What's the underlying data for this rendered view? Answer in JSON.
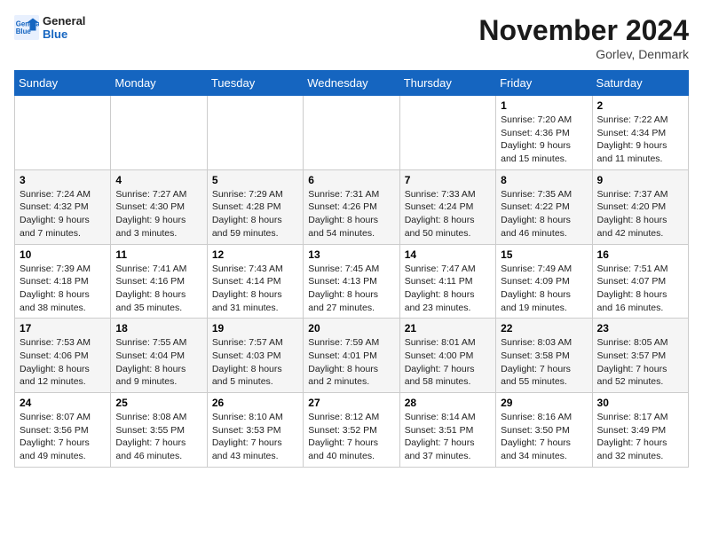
{
  "header": {
    "logo_line1": "General",
    "logo_line2": "Blue",
    "month": "November 2024",
    "location": "Gorlev, Denmark"
  },
  "weekdays": [
    "Sunday",
    "Monday",
    "Tuesday",
    "Wednesday",
    "Thursday",
    "Friday",
    "Saturday"
  ],
  "weeks": [
    [
      {
        "day": "",
        "info": ""
      },
      {
        "day": "",
        "info": ""
      },
      {
        "day": "",
        "info": ""
      },
      {
        "day": "",
        "info": ""
      },
      {
        "day": "",
        "info": ""
      },
      {
        "day": "1",
        "info": "Sunrise: 7:20 AM\nSunset: 4:36 PM\nDaylight: 9 hours and 15 minutes."
      },
      {
        "day": "2",
        "info": "Sunrise: 7:22 AM\nSunset: 4:34 PM\nDaylight: 9 hours and 11 minutes."
      }
    ],
    [
      {
        "day": "3",
        "info": "Sunrise: 7:24 AM\nSunset: 4:32 PM\nDaylight: 9 hours and 7 minutes."
      },
      {
        "day": "4",
        "info": "Sunrise: 7:27 AM\nSunset: 4:30 PM\nDaylight: 9 hours and 3 minutes."
      },
      {
        "day": "5",
        "info": "Sunrise: 7:29 AM\nSunset: 4:28 PM\nDaylight: 8 hours and 59 minutes."
      },
      {
        "day": "6",
        "info": "Sunrise: 7:31 AM\nSunset: 4:26 PM\nDaylight: 8 hours and 54 minutes."
      },
      {
        "day": "7",
        "info": "Sunrise: 7:33 AM\nSunset: 4:24 PM\nDaylight: 8 hours and 50 minutes."
      },
      {
        "day": "8",
        "info": "Sunrise: 7:35 AM\nSunset: 4:22 PM\nDaylight: 8 hours and 46 minutes."
      },
      {
        "day": "9",
        "info": "Sunrise: 7:37 AM\nSunset: 4:20 PM\nDaylight: 8 hours and 42 minutes."
      }
    ],
    [
      {
        "day": "10",
        "info": "Sunrise: 7:39 AM\nSunset: 4:18 PM\nDaylight: 8 hours and 38 minutes."
      },
      {
        "day": "11",
        "info": "Sunrise: 7:41 AM\nSunset: 4:16 PM\nDaylight: 8 hours and 35 minutes."
      },
      {
        "day": "12",
        "info": "Sunrise: 7:43 AM\nSunset: 4:14 PM\nDaylight: 8 hours and 31 minutes."
      },
      {
        "day": "13",
        "info": "Sunrise: 7:45 AM\nSunset: 4:13 PM\nDaylight: 8 hours and 27 minutes."
      },
      {
        "day": "14",
        "info": "Sunrise: 7:47 AM\nSunset: 4:11 PM\nDaylight: 8 hours and 23 minutes."
      },
      {
        "day": "15",
        "info": "Sunrise: 7:49 AM\nSunset: 4:09 PM\nDaylight: 8 hours and 19 minutes."
      },
      {
        "day": "16",
        "info": "Sunrise: 7:51 AM\nSunset: 4:07 PM\nDaylight: 8 hours and 16 minutes."
      }
    ],
    [
      {
        "day": "17",
        "info": "Sunrise: 7:53 AM\nSunset: 4:06 PM\nDaylight: 8 hours and 12 minutes."
      },
      {
        "day": "18",
        "info": "Sunrise: 7:55 AM\nSunset: 4:04 PM\nDaylight: 8 hours and 9 minutes."
      },
      {
        "day": "19",
        "info": "Sunrise: 7:57 AM\nSunset: 4:03 PM\nDaylight: 8 hours and 5 minutes."
      },
      {
        "day": "20",
        "info": "Sunrise: 7:59 AM\nSunset: 4:01 PM\nDaylight: 8 hours and 2 minutes."
      },
      {
        "day": "21",
        "info": "Sunrise: 8:01 AM\nSunset: 4:00 PM\nDaylight: 7 hours and 58 minutes."
      },
      {
        "day": "22",
        "info": "Sunrise: 8:03 AM\nSunset: 3:58 PM\nDaylight: 7 hours and 55 minutes."
      },
      {
        "day": "23",
        "info": "Sunrise: 8:05 AM\nSunset: 3:57 PM\nDaylight: 7 hours and 52 minutes."
      }
    ],
    [
      {
        "day": "24",
        "info": "Sunrise: 8:07 AM\nSunset: 3:56 PM\nDaylight: 7 hours and 49 minutes."
      },
      {
        "day": "25",
        "info": "Sunrise: 8:08 AM\nSunset: 3:55 PM\nDaylight: 7 hours and 46 minutes."
      },
      {
        "day": "26",
        "info": "Sunrise: 8:10 AM\nSunset: 3:53 PM\nDaylight: 7 hours and 43 minutes."
      },
      {
        "day": "27",
        "info": "Sunrise: 8:12 AM\nSunset: 3:52 PM\nDaylight: 7 hours and 40 minutes."
      },
      {
        "day": "28",
        "info": "Sunrise: 8:14 AM\nSunset: 3:51 PM\nDaylight: 7 hours and 37 minutes."
      },
      {
        "day": "29",
        "info": "Sunrise: 8:16 AM\nSunset: 3:50 PM\nDaylight: 7 hours and 34 minutes."
      },
      {
        "day": "30",
        "info": "Sunrise: 8:17 AM\nSunset: 3:49 PM\nDaylight: 7 hours and 32 minutes."
      }
    ]
  ]
}
